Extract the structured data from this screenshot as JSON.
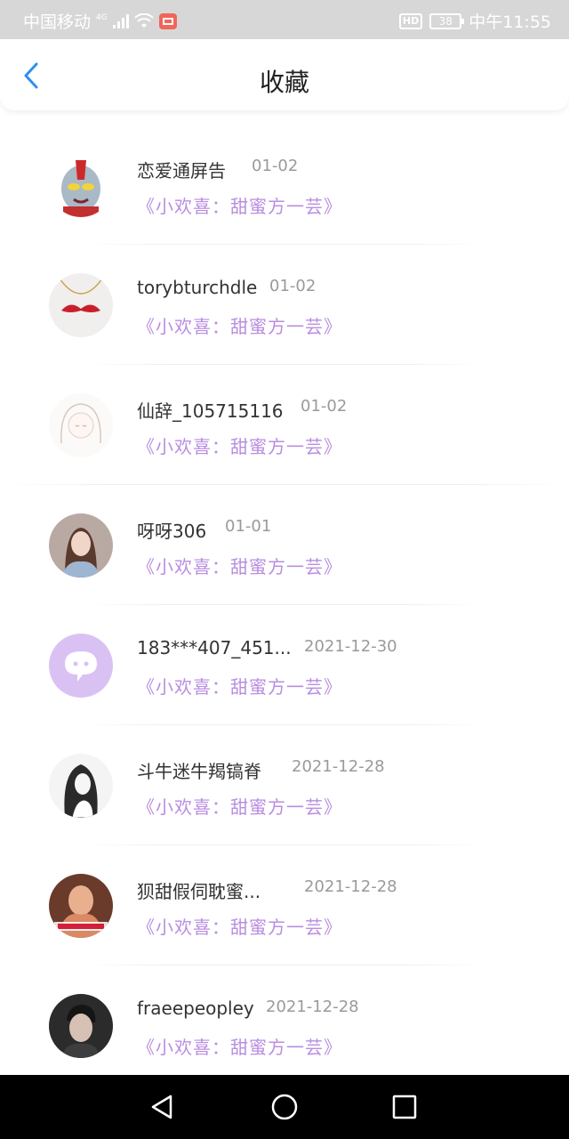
{
  "status_bar": {
    "carrier": "中国移动",
    "network": "4G",
    "hd": "HD",
    "battery": "38",
    "time": "中午11:55"
  },
  "header": {
    "title": "收藏",
    "back_icon": "chevron-left-icon",
    "accent_color": "#2f8fee"
  },
  "colors": {
    "work_title": "#b98ee0",
    "date": "#9a9a9a"
  },
  "favorites": [
    {
      "name": "恋爱通屏告",
      "date": "01-02",
      "work": "《小欢喜：甜蜜方一芸》"
    },
    {
      "name": "torybturchdle",
      "date": "01-02",
      "work": "《小欢喜：甜蜜方一芸》"
    },
    {
      "name": "仙辞_105715116",
      "date": "01-02",
      "work": "《小欢喜：甜蜜方一芸》"
    },
    {
      "name": "呀呀306",
      "date": "01-01",
      "work": "《小欢喜：甜蜜方一芸》"
    },
    {
      "name": "183***407_451...",
      "date": "2021-12-30",
      "work": "《小欢喜：甜蜜方一芸》"
    },
    {
      "name": "斗牛迷牛羯镐脊",
      "date": "2021-12-28",
      "work": "《小欢喜：甜蜜方一芸》"
    },
    {
      "name": "狈甜假伺耽蜜...",
      "date": "2021-12-28",
      "work": "《小欢喜：甜蜜方一芸》"
    },
    {
      "name": "fraeepeopley",
      "date": "2021-12-28",
      "work": "《小欢喜：甜蜜方一芸》"
    }
  ],
  "nav_bar": {
    "back": "triangle-back-icon",
    "home": "circle-home-icon",
    "recent": "square-recent-icon"
  }
}
